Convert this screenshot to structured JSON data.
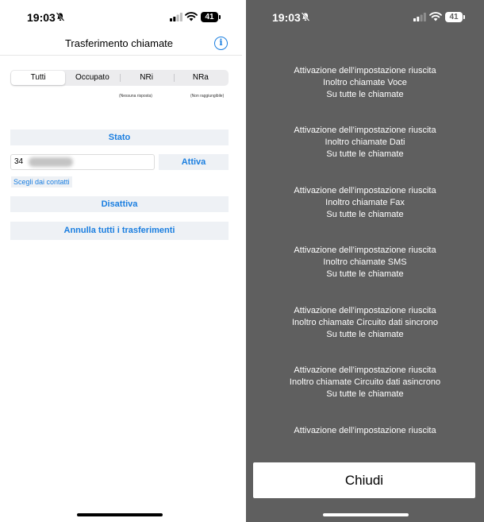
{
  "left": {
    "status": {
      "time": "19:03",
      "battery": "41"
    },
    "nav": {
      "title": "Trasferimento chiamate",
      "info_icon": "info-icon"
    },
    "segments": [
      "Tutti",
      "Occupato",
      "NRi",
      "NRa"
    ],
    "segment_notes": {
      "nri": "(Nessuna risposta)",
      "nra": "(Non raggiungibile)"
    },
    "buttons": {
      "stato": "Stato",
      "attiva": "Attiva",
      "disattiva": "Disattiva",
      "annulla": "Annulla tutti i trasferimenti"
    },
    "number_field": {
      "value": "34"
    },
    "contacts_link": "Scegli dai contatti"
  },
  "right": {
    "status": {
      "time": "19:03",
      "battery": "41"
    },
    "messages": [
      {
        "line1": "Attivazione dell’impostazione riuscita",
        "line2": "Inoltro chiamate Voce",
        "line3": "Su tutte le chiamate"
      },
      {
        "line1": "Attivazione dell’impostazione riuscita",
        "line2": "Inoltro chiamate Dati",
        "line3": "Su tutte le chiamate"
      },
      {
        "line1": "Attivazione dell’impostazione riuscita",
        "line2": "Inoltro chiamate Fax",
        "line3": "Su tutte le chiamate"
      },
      {
        "line1": "Attivazione dell’impostazione riuscita",
        "line2": "Inoltro chiamate SMS",
        "line3": "Su tutte le chiamate"
      },
      {
        "line1": "Attivazione dell’impostazione riuscita",
        "line2": "Inoltro chiamate Circuito dati sincrono",
        "line3": "Su tutte le chiamate"
      },
      {
        "line1": "Attivazione dell’impostazione riuscita",
        "line2": "Inoltro chiamate Circuito dati asincrono",
        "line3": "Su tutte le chiamate"
      },
      {
        "line1": "Attivazione dell’impostazione riuscita"
      }
    ],
    "close_label": "Chiudi"
  },
  "colors": {
    "accent": "#1a7ee0",
    "button_bg": "#eef1f5",
    "overlay_bg": "#5f5f5f"
  }
}
